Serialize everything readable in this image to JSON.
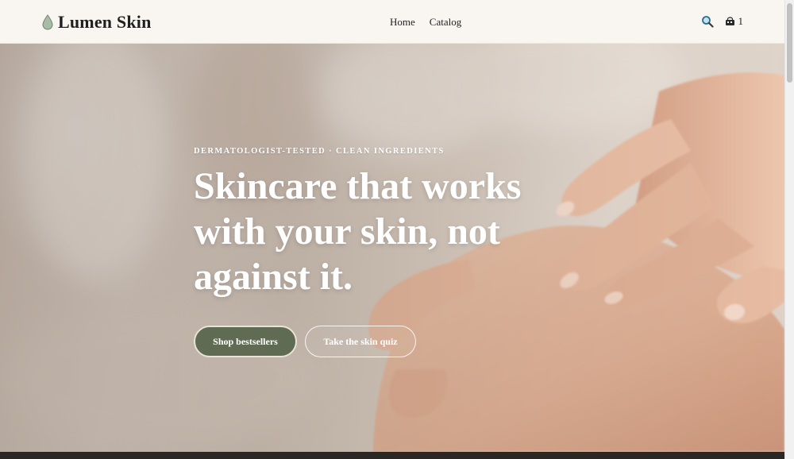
{
  "header": {
    "brand": "Lumen Skin",
    "nav": [
      {
        "label": "Home"
      },
      {
        "label": "Catalog"
      }
    ],
    "cart_count": "1",
    "icons": {
      "logo": "water-drop-icon",
      "search": "search-icon",
      "cart": "shopping-bag-icon"
    }
  },
  "hero": {
    "eyebrow": "DERMATOLOGIST-TESTED · CLEAN INGREDIENTS",
    "title_lines": [
      "Skincare that works",
      "with your skin, not",
      "against it."
    ],
    "primary_cta": "Shop bestsellers",
    "secondary_cta": "Take the skin quiz"
  },
  "colors": {
    "accent": "#5f6c53",
    "header_bg": "#f9f6f1",
    "text_dark": "#1f1f1f",
    "logo_drop": "#a8bba6"
  }
}
